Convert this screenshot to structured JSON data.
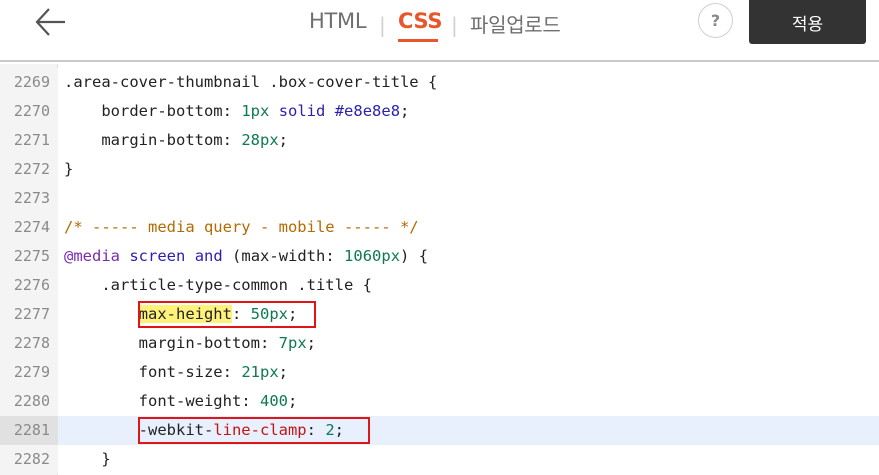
{
  "header": {
    "tabs": [
      {
        "label": "HTML",
        "active": false
      },
      {
        "label": "CSS",
        "active": true
      },
      {
        "label": "파일업로드",
        "active": false
      }
    ],
    "separator": "|",
    "help_label": "?",
    "apply_label": "적용",
    "icons": {
      "back": "arrow-left-icon",
      "help": "question-icon"
    }
  },
  "colors": {
    "active_tab": "#e8562a",
    "apply_button_bg": "#333333",
    "highlight_box": "#e01616",
    "active_line_bg": "#e8f0fd"
  },
  "editor": {
    "lines": [
      {
        "num": "2269",
        "text": ".area-cover-thumbnail .box-cover-title {"
      },
      {
        "num": "2270",
        "indent": "    ",
        "prop": "border-bottom",
        "colon": ":",
        "val1": "1px",
        "val2": "solid",
        "val3": "#e8e8e8",
        "semi": ";"
      },
      {
        "num": "2271",
        "indent": "    ",
        "prop": "margin-bottom",
        "colon": ":",
        "val": "28px",
        "semi": ";"
      },
      {
        "num": "2272",
        "text": "}"
      },
      {
        "num": "2273",
        "text": ""
      },
      {
        "num": "2274",
        "text": "/* ----- media query - mobile ----- */"
      },
      {
        "num": "2275",
        "at": "@media",
        "kw": "screen",
        "and": "and",
        "open": "(max-width:",
        "val": "1060px",
        "close": ") {"
      },
      {
        "num": "2276",
        "text": "    .article-type-common .title {"
      },
      {
        "num": "2277",
        "indent": "        ",
        "prop": "max-height",
        "colon": ":",
        "val": "50px",
        "semi": ";"
      },
      {
        "num": "2278",
        "indent": "        ",
        "prop": "margin-bottom",
        "colon": ":",
        "val": "7px",
        "semi": ";"
      },
      {
        "num": "2279",
        "indent": "        ",
        "prop": "font-size",
        "colon": ":",
        "val": "21px",
        "semi": ";"
      },
      {
        "num": "2280",
        "indent": "        ",
        "prop": "font-weight",
        "colon": ":",
        "val": "400",
        "semi": ";"
      },
      {
        "num": "2281",
        "indent": "        ",
        "prefix": "-webkit-",
        "prop": "line-clamp",
        "colon": ":",
        "val": "2",
        "semi": ";"
      },
      {
        "num": "2282",
        "text": "    }"
      }
    ]
  }
}
